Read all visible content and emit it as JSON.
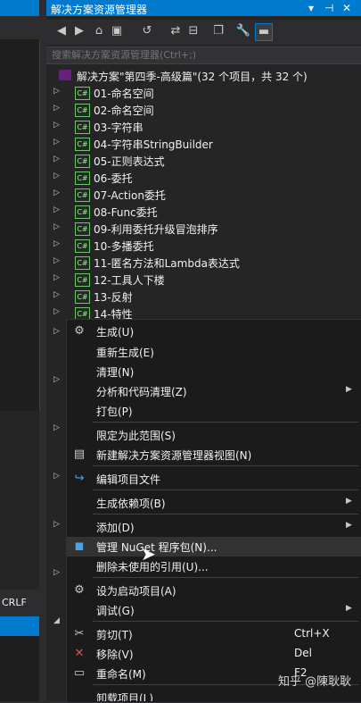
{
  "left": {
    "crlf": "CRLF"
  },
  "panel": {
    "title": "解决方案资源管理器",
    "search_placeholder": "搜索解决方案资源管理器(Ctrl+;)",
    "solution_label": "解决方案\"第四季-高级篇\"(32 个项目，共 32 个)"
  },
  "projects": [
    "01-命名空间",
    "02-命名空间",
    "03-字符串",
    "04-字符串StringBuilder",
    "05-正则表达式",
    "06-委托",
    "07-Action委托",
    "08-Func委托",
    "09-利用委托升级冒泡排序",
    "10-多播委托",
    "11-匿名方法和Lambda表达式",
    "12-工具人下楼",
    "13-反射",
    "14-特性"
  ],
  "menu": {
    "build": "生成(U)",
    "rebuild": "重新生成(E)",
    "clean": "清理(N)",
    "analyze": "分析和代码清理(Z)",
    "pack": "打包(P)",
    "scope": "限定为此范围(S)",
    "new_view": "新建解决方案资源管理器视图(N)",
    "edit_project": "编辑项目文件",
    "build_deps": "生成依赖项(B)",
    "add": "添加(D)",
    "nuget": "管理 NuGet 程序包(N)...",
    "remove_unused": "删除未使用的引用(U)...",
    "startup": "设为启动项目(A)",
    "debug": "调试(G)",
    "cut": "剪切(T)",
    "cut_short": "Ctrl+X",
    "remove": "移除(V)",
    "remove_short": "Del",
    "rename": "重命名(M)",
    "rename_short": "F2",
    "unload": "卸载项目(L)"
  },
  "watermark": "知乎 @陳耿耿"
}
